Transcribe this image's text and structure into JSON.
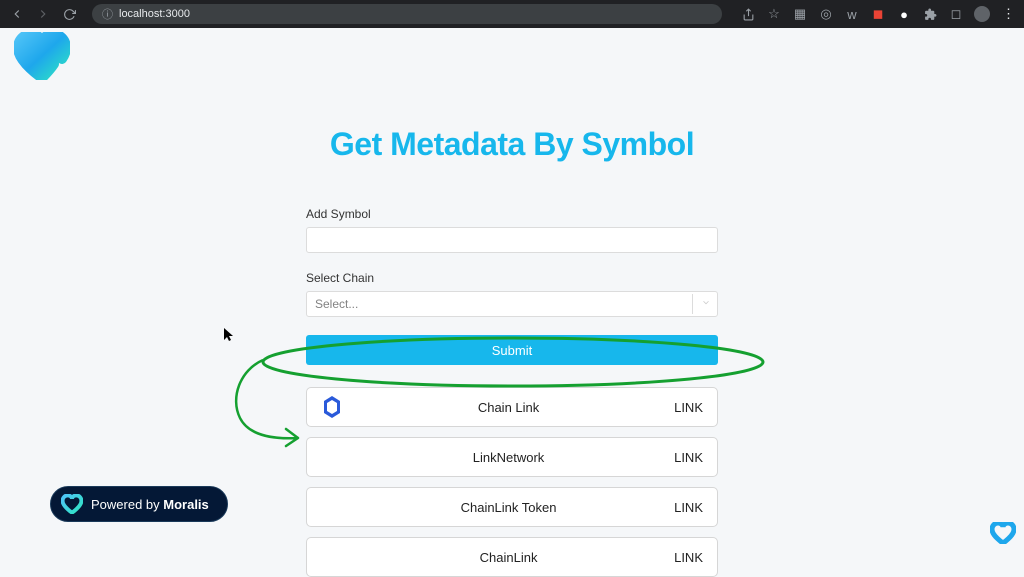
{
  "browser": {
    "url": "localhost:3000"
  },
  "page": {
    "title": "Get Metadata By Symbol",
    "addSymbolLabel": "Add Symbol",
    "selectChainLabel": "Select Chain",
    "selectPlaceholder": "Select...",
    "submitLabel": "Submit"
  },
  "results": [
    {
      "name": "Chain Link",
      "symbol": "LINK",
      "hasIcon": true
    },
    {
      "name": "LinkNetwork",
      "symbol": "LINK",
      "hasIcon": false
    },
    {
      "name": "ChainLink Token",
      "symbol": "LINK",
      "hasIcon": false
    },
    {
      "name": "ChainLink",
      "symbol": "LINK",
      "hasIcon": false
    }
  ],
  "footer": {
    "poweredPrefix": "Powered by ",
    "poweredName": "Moralis"
  }
}
